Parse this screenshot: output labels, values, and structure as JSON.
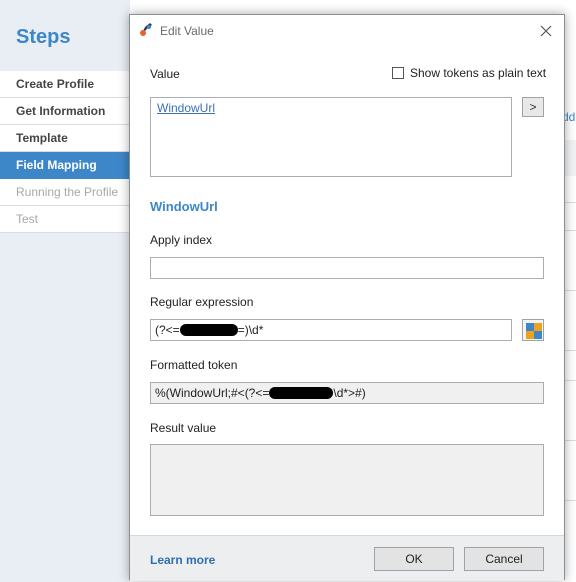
{
  "sidebar": {
    "title": "Steps",
    "items": [
      {
        "label": "Create Profile",
        "state": "normal"
      },
      {
        "label": "Get Information",
        "state": "normal"
      },
      {
        "label": "Template",
        "state": "normal"
      },
      {
        "label": "Field Mapping",
        "state": "active"
      },
      {
        "label": "Running the Profile",
        "state": "disabled"
      },
      {
        "label": "Test",
        "state": "disabled"
      }
    ]
  },
  "background": {
    "right_fragment": "dd"
  },
  "dialog": {
    "title": "Edit Value",
    "close_icon": "close-icon",
    "value_label": "Value",
    "show_tokens_label": "Show tokens as plain text",
    "show_tokens_checked": false,
    "value_token": "WindowUrl",
    "arrow_button_label": ">",
    "section_title": "WindowUrl",
    "apply_index_label": "Apply index",
    "apply_index_value": "",
    "regex_label": "Regular expression",
    "regex_prefix": "(?<=",
    "regex_suffix": "=)\\d*",
    "formatted_token_label": "Formatted token",
    "formatted_token_prefix": "%(WindowUrl;#<(?<=",
    "formatted_token_suffix": "\\d*>#)",
    "result_value_label": "Result value",
    "result_value": "",
    "learn_more": "Learn more",
    "ok_label": "OK",
    "cancel_label": "Cancel"
  },
  "colors": {
    "accent": "#3d87c8",
    "sidebar_bg": "#e9eef4",
    "footer_bg": "#eceef0",
    "redaction": "#000000"
  }
}
